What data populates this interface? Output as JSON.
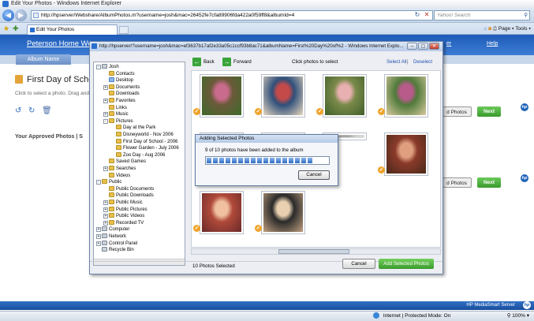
{
  "browser": {
    "window_title": "Edit Your Photos - Windows Internet Explorer",
    "address": "http://hpserver/Webshare/AlbumPhotos.m?username=josh&mac=26452fe7cfa89906fda422a0f59ff8&albumId=4",
    "search_placeholder": "Yahoo! Search",
    "tab_title": "Edit Your Photos",
    "command_bar": "Page ▾  Tools ▾",
    "status_zone": "Internet | Protected Mode: On",
    "zoom": "100%"
  },
  "page": {
    "site_title": "Peterson Home We",
    "user_link": "er",
    "help": "Help",
    "album_tab": "Album Name",
    "album_title": "First Day of Schoo",
    "hint": "Click to select a photo. Drag and",
    "approved_label": "Your Approved Photos | S",
    "add_photos_1": "d Photos",
    "next_1": "Next",
    "add_photos_2": "d Photos",
    "next_2": "Next",
    "footer": "HP MediaSmart Server"
  },
  "popup": {
    "title": "http://hpserver/?username=josh&mac=ef3637b17af2e33a05c1ccf93b8ac71&albumName=First%20Day%20of%2 - Windows Internet Explo...",
    "toolbar": {
      "back": "Back",
      "forward": "Forward",
      "hint": "Click photos to select",
      "select_all": "Select All",
      "separator": "|",
      "deselect": "Deselect"
    },
    "tree": [
      {
        "label": "Josh",
        "level": 0,
        "pm": "-",
        "icon": "grey"
      },
      {
        "label": "Contacts",
        "level": 1,
        "pm": "",
        "icon": "yellow"
      },
      {
        "label": "Desktop",
        "level": 1,
        "pm": "",
        "icon": "blue"
      },
      {
        "label": "Documents",
        "level": 1,
        "pm": "+",
        "icon": "yellow"
      },
      {
        "label": "Downloads",
        "level": 1,
        "pm": "",
        "icon": "yellow"
      },
      {
        "label": "Favorites",
        "level": 1,
        "pm": "+",
        "icon": "yellow"
      },
      {
        "label": "Links",
        "level": 1,
        "pm": "",
        "icon": "yellow"
      },
      {
        "label": "Music",
        "level": 1,
        "pm": "+",
        "icon": "yellow"
      },
      {
        "label": "Pictures",
        "level": 1,
        "pm": "-",
        "icon": "yellow"
      },
      {
        "label": "Day at the Park",
        "level": 2,
        "pm": "",
        "icon": "yellow"
      },
      {
        "label": "Disneyworld - Nov 2006",
        "level": 2,
        "pm": "",
        "icon": "yellow"
      },
      {
        "label": "First Day of School - 2006",
        "level": 2,
        "pm": "",
        "icon": "yellow"
      },
      {
        "label": "Flower Garden - July 2006",
        "level": 2,
        "pm": "",
        "icon": "yellow"
      },
      {
        "label": "Zoo Day - Aug 2006",
        "level": 2,
        "pm": "",
        "icon": "yellow"
      },
      {
        "label": "Saved Games",
        "level": 1,
        "pm": "",
        "icon": "yellow"
      },
      {
        "label": "Searches",
        "level": 1,
        "pm": "+",
        "icon": "yellow"
      },
      {
        "label": "Videos",
        "level": 1,
        "pm": "",
        "icon": "yellow"
      },
      {
        "label": "Public",
        "level": 0,
        "pm": "-",
        "icon": "yellow"
      },
      {
        "label": "Public Documents",
        "level": 1,
        "pm": "",
        "icon": "yellow"
      },
      {
        "label": "Public Downloads",
        "level": 1,
        "pm": "",
        "icon": "yellow"
      },
      {
        "label": "Public Music",
        "level": 1,
        "pm": "+",
        "icon": "yellow"
      },
      {
        "label": "Public Pictures",
        "level": 1,
        "pm": "+",
        "icon": "yellow"
      },
      {
        "label": "Public Videos",
        "level": 1,
        "pm": "+",
        "icon": "yellow"
      },
      {
        "label": "Recorded TV",
        "level": 1,
        "pm": "+",
        "icon": "yellow"
      },
      {
        "label": "Computer",
        "level": 0,
        "pm": "+",
        "icon": "grey"
      },
      {
        "label": "Network",
        "level": 0,
        "pm": "+",
        "icon": "grey"
      },
      {
        "label": "Control Panel",
        "level": 0,
        "pm": "+",
        "icon": "grey"
      },
      {
        "label": "Recycle Bin",
        "level": 0,
        "pm": "",
        "icon": "grey"
      }
    ],
    "photos_selected_count": 10,
    "photos": [
      {
        "palette": [
          "#6b5a3a",
          "#c96b8c",
          "#3d6b2a"
        ],
        "checked": true
      },
      {
        "palette": [
          "#2f4f7a",
          "#c44a4a",
          "#e8d8c0"
        ],
        "checked": true
      },
      {
        "palette": [
          "#7a8a4a",
          "#e8b0b0",
          "#3f5f2a"
        ],
        "checked": true
      },
      {
        "palette": [
          "#4f7a3a",
          "#b85a8a",
          "#d9c9a0"
        ],
        "checked": true
      },
      {
        "palette": [
          "#2a2a2a",
          "#d0d0d0",
          "#888888"
        ],
        "checked": false
      },
      {
        "palette": [
          "#cfcfcf",
          "#9a9a9a",
          "#e0e0e0"
        ],
        "checked": false
      },
      {
        "palette": [
          "#cfcfcf",
          "#9a9a9a",
          "#e0e0e0"
        ],
        "checked": false
      },
      {
        "palette": [
          "#8a3a2a",
          "#e0a080",
          "#4a2a1a"
        ],
        "checked": true
      },
      {
        "palette": [
          "#b04a3a",
          "#f0c0a0",
          "#6a2a2a"
        ],
        "checked": true
      },
      {
        "palette": [
          "#2a2a2a",
          "#e8d0b0",
          "#c0a080"
        ],
        "checked": true
      }
    ],
    "status": "10 Photos Selected",
    "cancel": "Cancel",
    "add_selected": "Add Selected Photos"
  },
  "dialog": {
    "title": "Adding Selected Photos",
    "message": "9 of 10 photos have been added to the album",
    "progress": 0.9,
    "cancel": "Cancel"
  },
  "colors": {
    "brand_blue": "#1d5bb8",
    "accent_green": "#3a9a2d",
    "check_orange": "#f0a32a"
  }
}
